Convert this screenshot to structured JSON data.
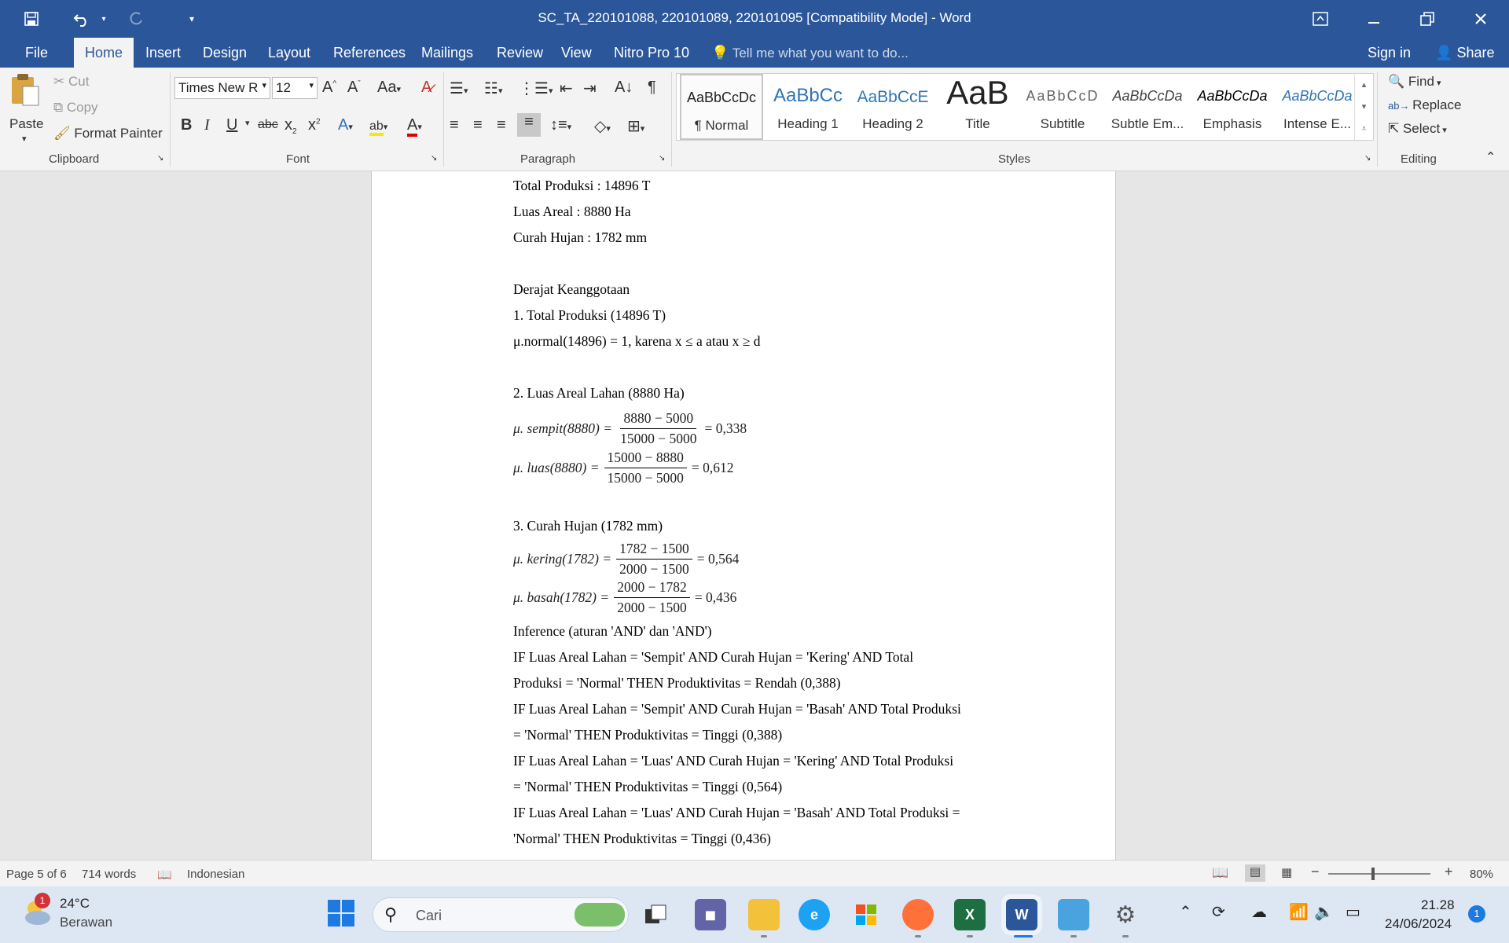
{
  "window": {
    "title": "SC_TA_220101088, 220101089, 220101095 [Compatibility Mode] - Word",
    "icons": [
      "save-icon",
      "undo-icon",
      "redo-icon",
      "customize-quick-access-icon",
      "ribbon-display-options-icon",
      "minimize-icon",
      "restore-icon",
      "close-icon"
    ]
  },
  "menu": {
    "tabs": [
      "File",
      "Home",
      "Insert",
      "Design",
      "Layout",
      "References",
      "Mailings",
      "Review",
      "View",
      "Nitro Pro 10"
    ],
    "active": "Home",
    "tell_me": "Tell me what you want to do...",
    "sign_in": "Sign in",
    "share": "Share"
  },
  "ribbon": {
    "clipboard": {
      "paste": "Paste",
      "cut": "Cut",
      "copy": "Copy",
      "format_painter": "Format Painter",
      "label": "Clipboard"
    },
    "font": {
      "name": "Times New R",
      "size": "12",
      "label": "Font",
      "bold": "B",
      "italic": "I",
      "underline": "U",
      "strike": "abc"
    },
    "paragraph": {
      "label": "Paragraph"
    },
    "styles": {
      "label": "Styles",
      "items": [
        {
          "sample": "AaBbCcDc",
          "name": "¶ Normal"
        },
        {
          "sample": "AaBbCc",
          "name": "Heading 1"
        },
        {
          "sample": "AaBbCcE",
          "name": "Heading 2"
        },
        {
          "sample": "AaB",
          "name": "Title"
        },
        {
          "sample": "AaBbCcD",
          "name": "Subtitle"
        },
        {
          "sample": "AaBbCcDa",
          "name": "Subtle Em..."
        },
        {
          "sample": "AaBbCcDa",
          "name": "Emphasis"
        },
        {
          "sample": "AaBbCcDa",
          "name": "Intense E..."
        }
      ]
    },
    "editing": {
      "find": "Find",
      "replace": "Replace",
      "select": "Select",
      "label": "Editing"
    }
  },
  "document": {
    "lines": {
      "l1": "Total Produksi : 14896 T",
      "l2": "Luas Areal : 8880 Ha",
      "l3": "Curah Hujan : 1782 mm",
      "l4": "Derajat Keanggotaan",
      "l5": "1. Total Produksi (14896 T)",
      "l6": "μ.normal(14896) = 1, karena x ≤ a atau x ≥ d",
      "l7": "2. Luas Areal Lahan (8880 Ha)",
      "l8": "3. Curah Hujan (1782 mm)",
      "l9": "Inference (aturan 'AND' dan 'AND')",
      "r1a": "IF Luas Areal Lahan = 'Sempit' AND Curah Hujan = 'Kering' AND Total",
      "r1b": "Produksi = 'Normal' THEN Produktivitas = Rendah (0,388)",
      "r2a": "IF Luas Areal Lahan = 'Sempit' AND Curah Hujan = 'Basah' AND Total Produksi",
      "r2b": "= 'Normal' THEN Produktivitas = Tinggi (0,388)",
      "r3a": "IF Luas Areal Lahan = 'Luas' AND Curah Hujan = 'Kering' AND Total Produksi",
      "r3b": "= 'Normal' THEN Produktivitas = Tinggi (0,564)",
      "r4a": "IF Luas Areal Lahan = 'Luas' AND Curah Hujan = 'Basah' AND Total Produksi =",
      "r4b": "'Normal' THEN Produktivitas = Tinggi (0,436)"
    },
    "equations": {
      "sempit": {
        "lhs": "μ. sempit(8880) =",
        "num": "8880 − 5000",
        "den": "15000 − 5000",
        "rhs": "= 0,338"
      },
      "luas": {
        "lhs": "μ. luas(8880) =",
        "num": "15000 − 8880",
        "den": "15000 − 5000",
        "rhs": "= 0,612"
      },
      "kering": {
        "lhs": "μ. kering(1782) =",
        "num": "1782 − 1500",
        "den": "2000 − 1500",
        "rhs": "= 0,564"
      },
      "basah": {
        "lhs": "μ. basah(1782) =",
        "num": "2000 − 1782",
        "den": "2000 − 1500",
        "rhs": "= 0,436"
      }
    }
  },
  "status": {
    "page": "Page 5 of 6",
    "words": "714 words",
    "language": "Indonesian",
    "zoom": "80%",
    "zoom_level": 0.44
  },
  "taskbar": {
    "weather_temp": "24°C",
    "weather_desc": "Berawan",
    "weather_badge": "1",
    "search": "Cari",
    "time": "21.28",
    "date": "24/06/2024",
    "notification_count": "1"
  }
}
